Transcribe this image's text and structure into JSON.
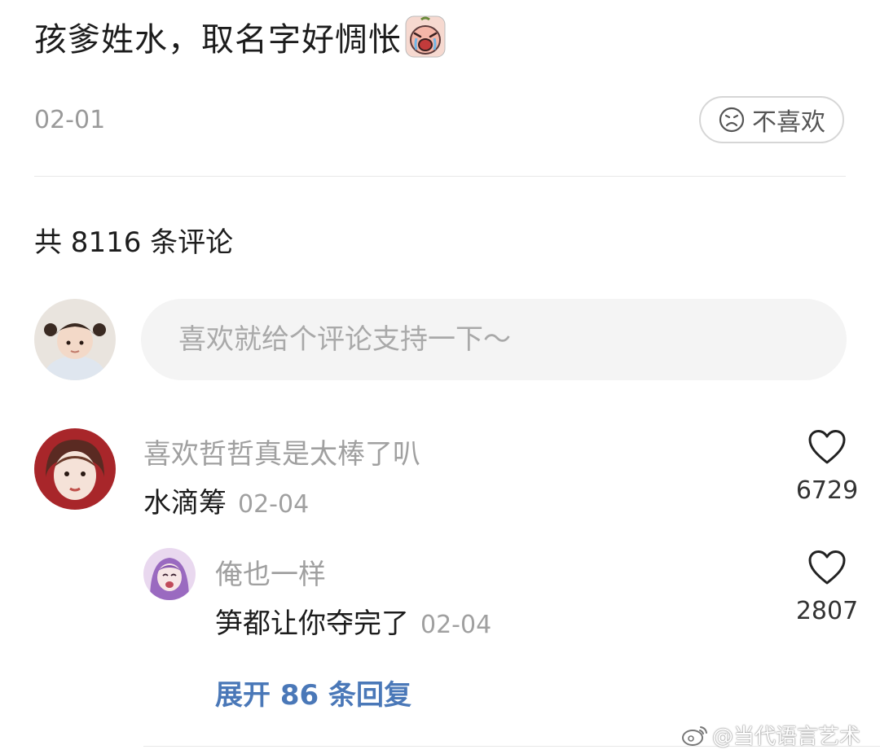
{
  "post": {
    "title": "孩爹姓水，取名字好惆怅",
    "emoji": "crying-face-icon",
    "date": "02-01",
    "dislike_label": "不喜欢"
  },
  "comments_header": {
    "count_text": "共 8116 条评论"
  },
  "comment_input": {
    "placeholder": "喜欢就给个评论支持一下～"
  },
  "comments": [
    {
      "username": "喜欢哲哲真是太棒了叭",
      "text": "水滴筹",
      "date": "02-04",
      "likes": "6729"
    }
  ],
  "replies": [
    {
      "username": "俺也一样",
      "text": "笋都让你夺完了",
      "date": "02-04",
      "likes": "2807"
    }
  ],
  "expand_replies_label": "展开 86 条回复",
  "watermark": {
    "text": "@当代语言艺术",
    "icon": "weibo-icon"
  },
  "colors": {
    "link": "#4a78b8",
    "muted": "#a0a0a0",
    "input_bg": "#f4f4f4"
  }
}
